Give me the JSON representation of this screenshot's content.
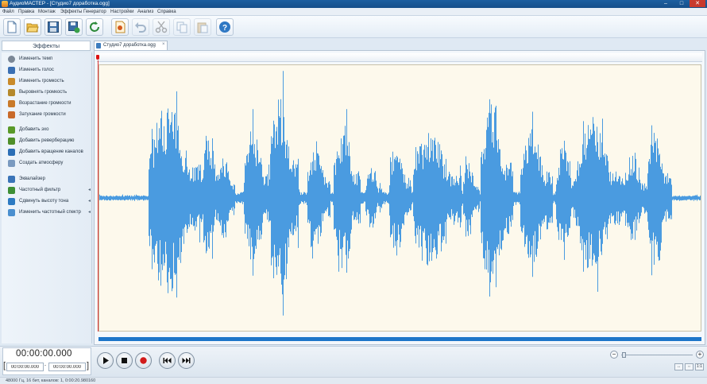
{
  "window": {
    "title": "АудиоМАСТЕР - [Студио7 доработка.ogg]",
    "minimize_glyph": "–",
    "maximize_glyph": "□",
    "close_glyph": "✕"
  },
  "menu": [
    "Файл",
    "Правка",
    "Монтаж",
    "Эффекты",
    "Генератор",
    "Настройки",
    "Анализ",
    "Справка"
  ],
  "toolbar": {
    "buttons": [
      {
        "name": "new-file-button",
        "icon": "new-file-icon",
        "enabled": true
      },
      {
        "name": "open-file-button",
        "icon": "folder-open-icon",
        "enabled": true
      },
      {
        "name": "save-button",
        "icon": "floppy-disk-icon",
        "enabled": true
      },
      {
        "name": "save-as-button",
        "icon": "save-as-icon",
        "enabled": true
      },
      {
        "name": "convert-button",
        "icon": "refresh-icon",
        "enabled": true
      },
      {
        "name": "record-button",
        "icon": "record-document-icon",
        "enabled": true
      },
      {
        "name": "undo-button",
        "icon": "undo-icon",
        "enabled": false
      },
      {
        "name": "cut-button",
        "icon": "scissors-icon",
        "enabled": false
      },
      {
        "name": "copy-button",
        "icon": "copy-icon",
        "enabled": false
      },
      {
        "name": "paste-button",
        "icon": "paste-icon",
        "enabled": false
      },
      {
        "name": "help-button",
        "icon": "help-icon",
        "enabled": true
      }
    ]
  },
  "effects_panel": {
    "tab_label": "Эффекты",
    "items": [
      {
        "label": "Изменить темп",
        "icon": "tempo-icon",
        "color": "#7b8796",
        "has_arrow": false
      },
      {
        "label": "Изменить голос",
        "icon": "voice-icon",
        "color": "#3a6fb3",
        "has_arrow": false
      },
      {
        "label": "Изменить громкость",
        "icon": "volume-icon",
        "color": "#c98a2a",
        "has_arrow": false
      },
      {
        "label": "Выровнять громкость",
        "icon": "normalize-icon",
        "color": "#b5892c",
        "has_arrow": false
      },
      {
        "label": "Возрастание громкости",
        "icon": "fade-in-icon",
        "color": "#c97a2a",
        "has_arrow": false
      },
      {
        "label": "Затухание громкости",
        "icon": "fade-out-icon",
        "color": "#c96a2a",
        "has_arrow": false
      },
      {
        "label": "Добавить эхо",
        "icon": "echo-icon",
        "color": "#5a9a2a",
        "has_arrow": false
      },
      {
        "label": "Добавить реверберацию",
        "icon": "reverb-icon",
        "color": "#4f8f2a",
        "has_arrow": false
      },
      {
        "label": "Добавить вращение каналов",
        "icon": "channel-rotation-icon",
        "color": "#2c6fb6",
        "has_arrow": false
      },
      {
        "label": "Создать атмосферу",
        "icon": "atmosphere-icon",
        "color": "#7a9ac0",
        "has_arrow": false
      },
      {
        "label": "Эквалайзер",
        "icon": "equalizer-icon",
        "color": "#3a74b8",
        "has_arrow": false
      },
      {
        "label": "Частотный фильтр",
        "icon": "filter-icon",
        "color": "#3e8f36",
        "has_arrow": true
      },
      {
        "label": "Сдвинуть высоту тона",
        "icon": "pitch-shift-icon",
        "color": "#2d7ac2",
        "has_arrow": true
      },
      {
        "label": "Изменить частотный спектр",
        "icon": "spectrum-icon",
        "color": "#4b8fcf",
        "has_arrow": true
      }
    ],
    "arrow_glyph": "◂"
  },
  "document": {
    "tab_label": "Студио7 доработка.ogg",
    "close_glyph": "×"
  },
  "waveform": {
    "color": "#4a9be0",
    "background": "#fdf9ec"
  },
  "transport": {
    "time_display": "00:00:00.000",
    "range_start": "00:00:00.000",
    "range_end": "00:00:00.000",
    "range_separator": "-",
    "bracket_left": "[",
    "bracket_right": "]",
    "buttons": [
      {
        "name": "play-button",
        "icon": "play-icon"
      },
      {
        "name": "stop-button",
        "icon": "stop-icon"
      },
      {
        "name": "record-audio-button",
        "icon": "record-icon"
      },
      {
        "name": "rewind-button",
        "icon": "skip-back-icon"
      },
      {
        "name": "forward-button",
        "icon": "skip-forward-icon"
      }
    ]
  },
  "zoom": {
    "minus": "−",
    "plus": "+",
    "level": 0.05,
    "fit_buttons": [
      "↔",
      "⇔",
      "1:1"
    ]
  },
  "status": {
    "text": "48000 Гц, 16 бит, каналов: 1, 0:00:20.980160"
  }
}
